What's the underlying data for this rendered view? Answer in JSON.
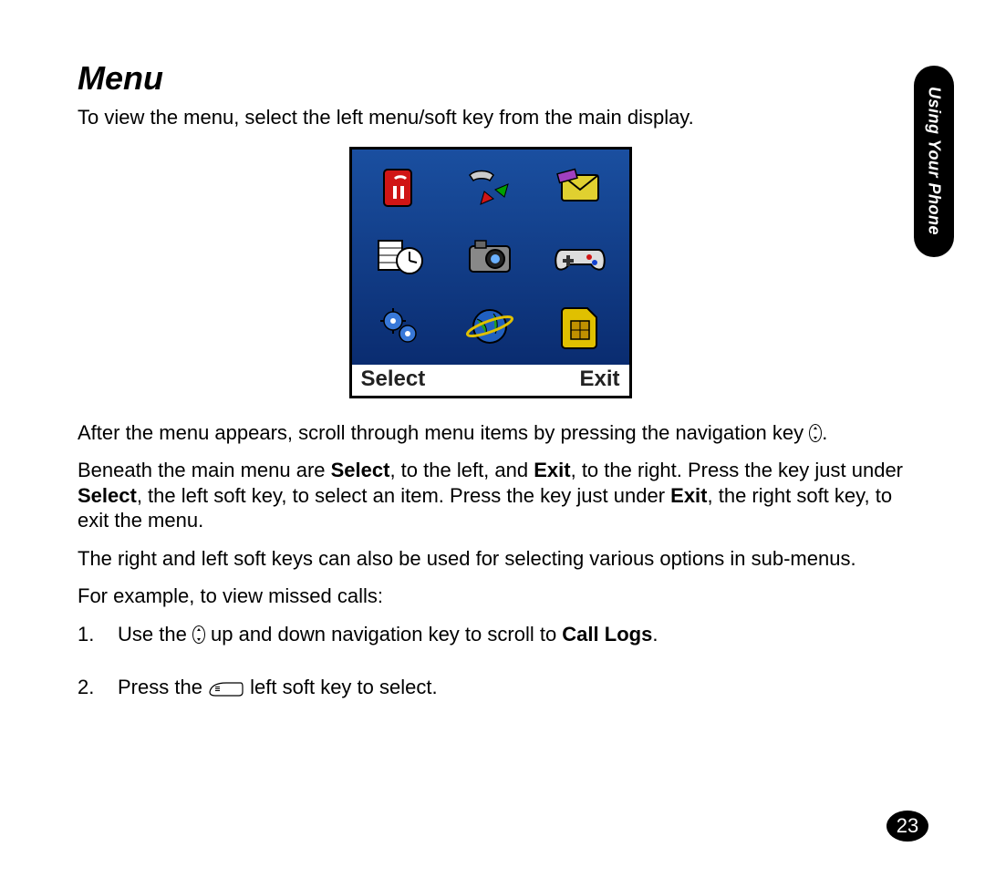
{
  "tab": "Using Your Phone",
  "page_number": "23",
  "heading": "Menu",
  "intro": "To view the menu, select the left menu/soft key from the main display.",
  "screen": {
    "soft_left": "Select",
    "soft_right": "Exit",
    "icons": [
      "phonebook-icon",
      "call-logs-icon",
      "messages-icon",
      "calendar-clock-icon",
      "camera-icon",
      "games-icon",
      "settings-gears-icon",
      "browser-globe-icon",
      "sim-icon"
    ]
  },
  "para_after_menu_1": "After the menu appears, scroll through menu items by pressing the navigation key ",
  "para_after_menu_2": ".",
  "para_beneath_pre": "Beneath the main menu are ",
  "bold_select": "Select",
  "para_beneath_mid1": ", to the left, and ",
  "bold_exit": "Exit",
  "para_beneath_mid2": ", to the right. Press the key just under ",
  "para_beneath_mid3": ", the left soft key, to select an item. Press the key just under ",
  "para_beneath_end": ", the right soft key, to exit the menu.",
  "para_submenus": "The right and left soft keys can also be used for selecting various options in sub-menus.",
  "para_example": "For example, to view missed calls:",
  "step1_a": "Use the ",
  "step1_b": " up and down navigation key to scroll to ",
  "call_logs": "Call Logs",
  "step1_c": ".",
  "step2_a": "Press the ",
  "step2_b": " left soft key to select."
}
